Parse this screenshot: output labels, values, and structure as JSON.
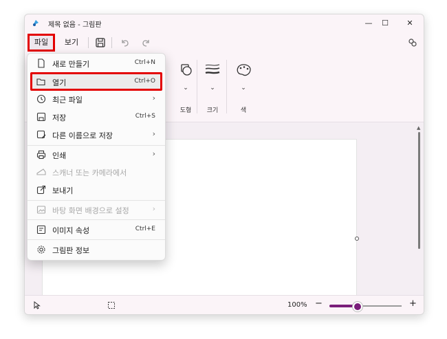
{
  "window": {
    "title": "제목 없음 - 그림판",
    "minimize": "—",
    "maximize": "☐",
    "close": "✕"
  },
  "menubar": {
    "file": "파일",
    "view": "보기"
  },
  "toolbar": {
    "shapes_label": "도형",
    "size_label": "크기",
    "color_label": "색"
  },
  "file_menu": {
    "items": [
      {
        "label": "새로 만들기",
        "shortcut": "Ctrl+N"
      },
      {
        "label": "열기",
        "shortcut": "Ctrl+O"
      },
      {
        "label": "최근 파일",
        "shortcut": ""
      },
      {
        "label": "저장",
        "shortcut": "Ctrl+S"
      },
      {
        "label": "다른 이름으로 저장",
        "shortcut": ""
      },
      {
        "label": "인쇄",
        "shortcut": ""
      },
      {
        "label": "스캐너 또는 카메라에서",
        "shortcut": ""
      },
      {
        "label": "보내기",
        "shortcut": ""
      },
      {
        "label": "바탕 화면 배경으로 설정",
        "shortcut": ""
      },
      {
        "label": "이미지 속성",
        "shortcut": "Ctrl+E"
      },
      {
        "label": "그림판 정보",
        "shortcut": ""
      }
    ],
    "submenu_arrow": "›"
  },
  "statusbar": {
    "zoom": "100%",
    "zoom_level": 0.38,
    "minus": "−",
    "plus": "+"
  },
  "colors": {
    "accent": "#7a1e7a",
    "highlight_border": "#e30000"
  }
}
